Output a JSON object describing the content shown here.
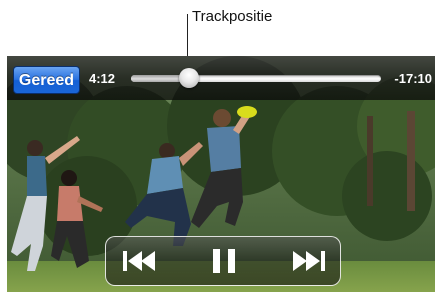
{
  "callout": {
    "label": "Trackpositie"
  },
  "player": {
    "done_label": "Gereed",
    "elapsed": "4:12",
    "remaining": "-17:10",
    "progress_fraction": 0.23
  },
  "controls": {
    "previous_icon": "previous-track-icon",
    "pause_icon": "pause-icon",
    "next_icon": "next-track-icon"
  },
  "colors": {
    "done_button": "#1a66d8",
    "controls_border": "#ffffff"
  }
}
